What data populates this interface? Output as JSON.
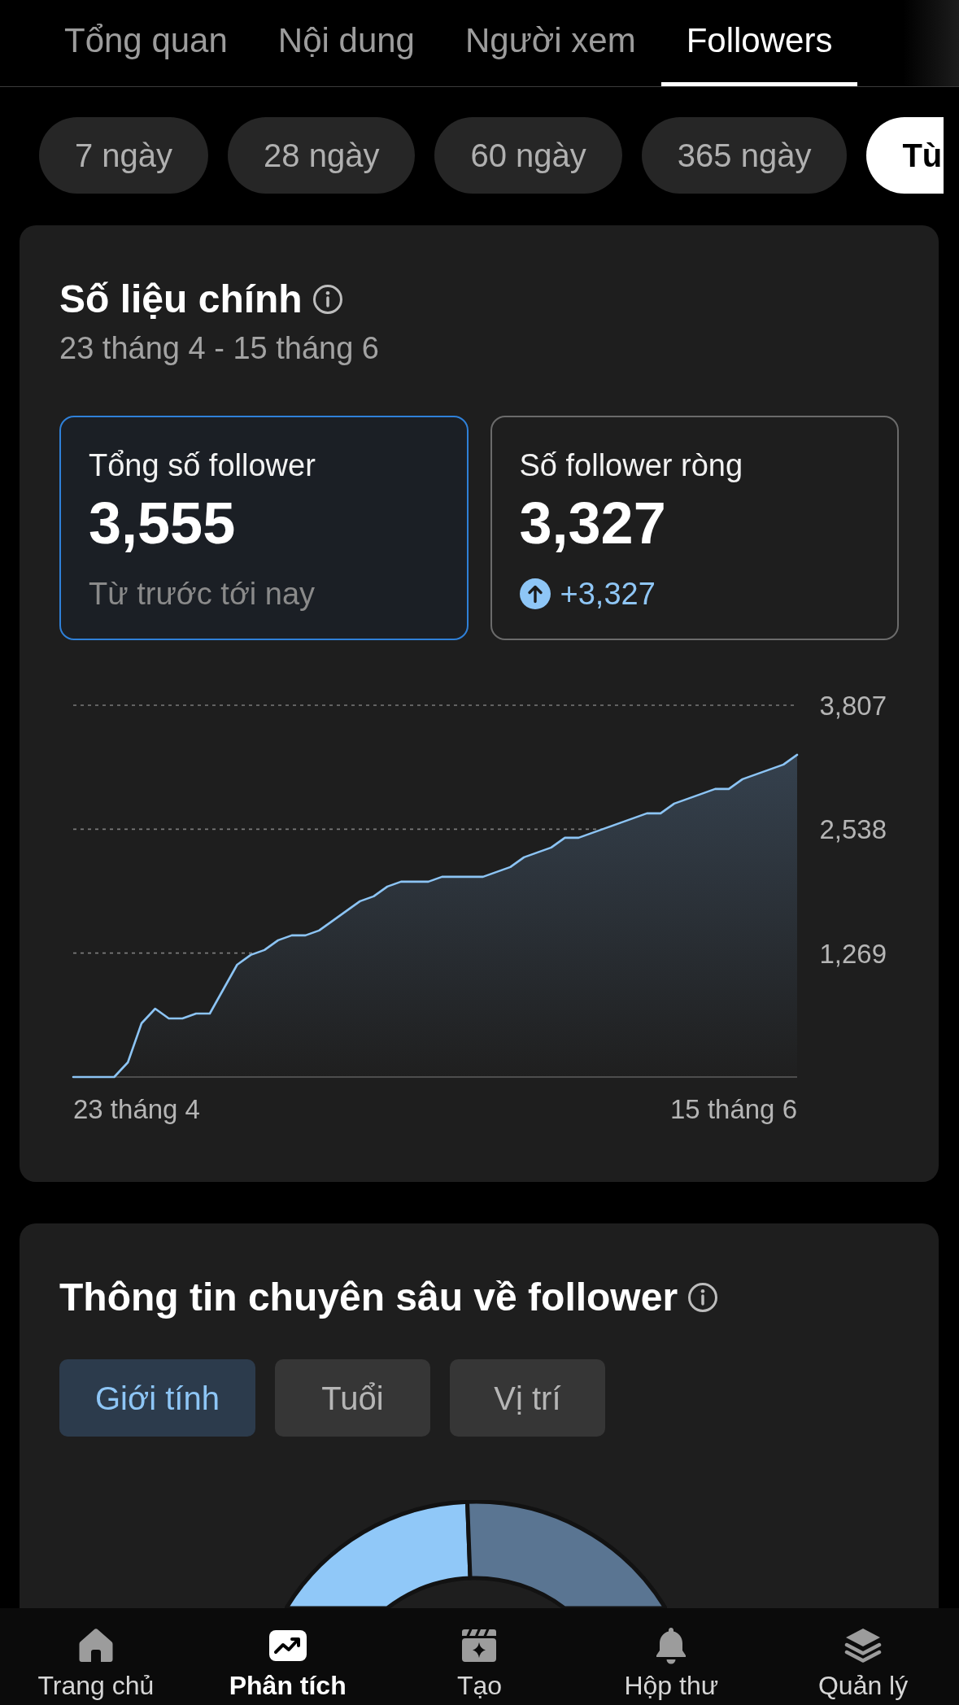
{
  "tabs": [
    {
      "label": "Tổng quan",
      "selected": false
    },
    {
      "label": "Nội dung",
      "selected": false
    },
    {
      "label": "Người xem",
      "selected": false
    },
    {
      "label": "Followers",
      "selected": true
    }
  ],
  "date_ranges": [
    {
      "label": "7 ngày",
      "selected": false
    },
    {
      "label": "28 ngày",
      "selected": false
    },
    {
      "label": "60 ngày",
      "selected": false
    },
    {
      "label": "365 ngày",
      "selected": false
    },
    {
      "label": "Tù",
      "selected": true
    }
  ],
  "key_metrics": {
    "title": "Số liệu chính",
    "date_range": "23 tháng 4 - 15 tháng 6",
    "stats": [
      {
        "label": "Tổng số follower",
        "value": "3,555",
        "selected": true,
        "footer": {
          "kind": "note",
          "text": "Từ trước tới nay"
        }
      },
      {
        "label": "Số follower ròng",
        "value": "3,327",
        "selected": false,
        "footer": {
          "kind": "increase",
          "text": "+3,327"
        }
      }
    ],
    "chart_data": {
      "type": "area",
      "ylim": [
        0,
        3807
      ],
      "yticks": [
        {
          "value": 1269,
          "label": "1,269"
        },
        {
          "value": 2538,
          "label": "2,538"
        },
        {
          "value": 3807,
          "label": "3,807"
        }
      ],
      "values": [
        0,
        0,
        0,
        0,
        150,
        550,
        700,
        600,
        600,
        650,
        650,
        900,
        1150,
        1250,
        1300,
        1400,
        1450,
        1450,
        1500,
        1600,
        1700,
        1800,
        1850,
        1950,
        2000,
        2000,
        2000,
        2050,
        2050,
        2050,
        2050,
        2100,
        2150,
        2250,
        2300,
        2350,
        2450,
        2450,
        2500,
        2550,
        2600,
        2650,
        2700,
        2700,
        2800,
        2850,
        2900,
        2950,
        2950,
        3050,
        3100,
        3150,
        3200,
        3300
      ]
    },
    "chart_range_labels": [
      "23 tháng 4",
      "15 tháng 6"
    ]
  },
  "follower_insights": {
    "title": "Thông tin chuyên sâu về follower",
    "segments": [
      {
        "label": "Giới tính",
        "selected": true
      },
      {
        "label": "Tuổi",
        "selected": false
      },
      {
        "label": "Vị trí",
        "selected": false
      }
    ]
  },
  "bottom_nav": [
    {
      "label": "Trang chủ",
      "selected": false
    },
    {
      "label": "Phân tích",
      "selected": true
    },
    {
      "label": "Tạo",
      "selected": false
    },
    {
      "label": "Hộp thư",
      "selected": false
    },
    {
      "label": "Quản lý",
      "selected": false
    }
  ]
}
